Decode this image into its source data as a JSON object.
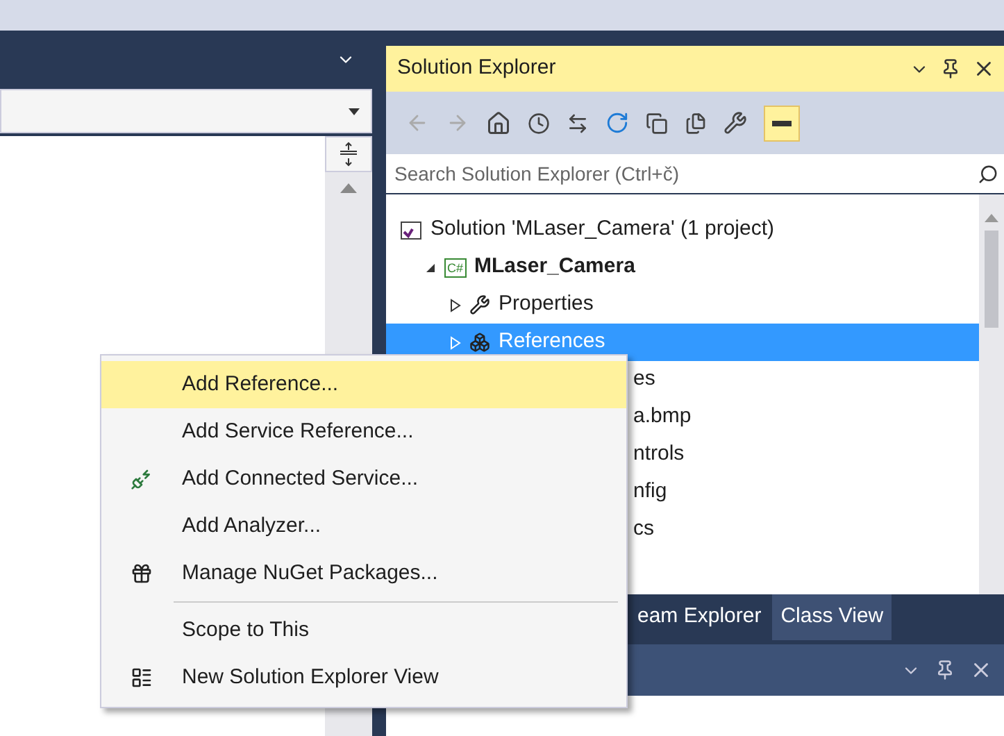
{
  "solution_explorer": {
    "title": "Solution Explorer",
    "search": {
      "placeholder": "Search Solution Explorer (Ctrl+č)"
    },
    "tree": [
      {
        "label": "Solution 'MLaser_Camera' (1 project)",
        "kind": "solution",
        "selected": false,
        "children": [
          {
            "label": "MLaser_Camera",
            "kind": "project",
            "badge": "C#",
            "selected": false,
            "expanded": true,
            "children": [
              {
                "label": "Properties",
                "kind": "properties",
                "selected": false,
                "expanded": false
              },
              {
                "label": "References",
                "kind": "references",
                "selected": true,
                "expanded": false
              },
              {
                "label": "es",
                "kind": "covered",
                "selected": false
              },
              {
                "label": "a.bmp",
                "kind": "covered",
                "selected": false
              },
              {
                "label": "ntrols",
                "kind": "covered",
                "selected": false
              },
              {
                "label": "nfig",
                "kind": "covered",
                "selected": false
              },
              {
                "label": "cs",
                "kind": "covered",
                "selected": false
              }
            ]
          }
        ]
      }
    ]
  },
  "tabs": [
    {
      "label": "eam Explorer",
      "selected": false
    },
    {
      "label": "Class View",
      "selected": true
    }
  ],
  "context_menu": {
    "items": [
      {
        "label": "Add Reference...",
        "kind": "plain",
        "selected": true
      },
      {
        "label": "Add Service Reference...",
        "kind": "plain",
        "selected": false
      },
      {
        "label": "Add Connected Service...",
        "kind": "connected-service",
        "selected": false
      },
      {
        "label": "Add Analyzer...",
        "kind": "plain",
        "selected": false
      },
      {
        "label": "Manage NuGet Packages...",
        "kind": "nuget",
        "selected": false
      },
      {
        "kind": "separator"
      },
      {
        "label": "Scope to This",
        "kind": "plain",
        "selected": false
      },
      {
        "label": "New Solution Explorer View",
        "kind": "new-view",
        "selected": false
      }
    ]
  }
}
